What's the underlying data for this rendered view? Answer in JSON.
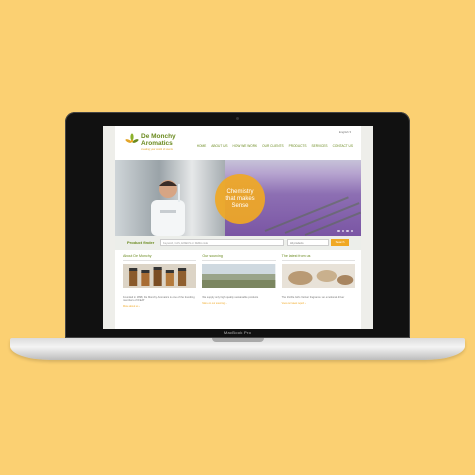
{
  "laptop": {
    "model_label": "MacBook Pro"
  },
  "site": {
    "logo": {
      "line1": "De Monchy",
      "line2": "Aromatics",
      "tagline": "creating your world of scents"
    },
    "language": "English ▾",
    "nav": [
      "HOME",
      "ABOUT US",
      "HOW WE WORK",
      "OUR CLIENTS",
      "PRODUCTS",
      "SERVICES",
      "CONTACT US"
    ],
    "hero": {
      "line1": "Chemistry",
      "line2": "that makes",
      "line3": "Sense"
    },
    "finder": {
      "label": "Product finder",
      "placeholder": "Keyword, CAS, EINECS or FEMA code",
      "select": "All products",
      "button": "Search"
    },
    "columns": [
      {
        "title": "About De Monchy",
        "text": "Founded in 1898, De Monchy Aromatics is one of the founding members of IFEAT",
        "more": "More about us ›"
      },
      {
        "title": "Our sourcing",
        "text": "We supply only high quality sustainable products",
        "more": "More on our sourcing ›"
      },
      {
        "title": "The latest from us",
        "text": "The Iris/De Girls Vetiver fragrance: an emotional driver",
        "more": "View our latest report ›"
      }
    ]
  },
  "colors": {
    "background": "#fbd072",
    "brand_green": "#6a8a1e",
    "accent_orange": "#f0a824",
    "lavender": "#7a55a4"
  }
}
